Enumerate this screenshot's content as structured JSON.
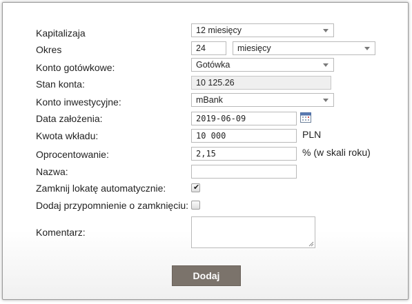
{
  "form": {
    "capitalization": {
      "label": "Kapitalizaja",
      "value": "12 miesięcy"
    },
    "period": {
      "label": "Okres",
      "value": "24",
      "unit": "miesięcy"
    },
    "cash_account": {
      "label": "Konto gotówkowe:",
      "value": "Gotówka"
    },
    "balance": {
      "label": "Stan konta:",
      "value": "10 125.26"
    },
    "investment_account": {
      "label": "Konto inwestycyjne:",
      "value": "mBank"
    },
    "start_date": {
      "label": "Data założenia:",
      "value": "2019-06-09"
    },
    "deposit_amount": {
      "label": "Kwota wkładu:",
      "value": "10 000",
      "suffix": "PLN"
    },
    "interest_rate": {
      "label": "Oprocentowanie:",
      "value": "2,15",
      "suffix": "% (w skali roku)"
    },
    "name": {
      "label": "Nazwa:",
      "value": ""
    },
    "auto_close": {
      "label": "Zamknij lokatę automatycznie:",
      "checked": true
    },
    "reminder": {
      "label": "Dodaj przypomnienie o zamknięciu:",
      "checked": false
    },
    "comment": {
      "label": "Komentarz:",
      "value": ""
    },
    "submit_label": "Dodaj"
  },
  "icons": {
    "calendar": "calendar-icon",
    "dropdown": "chevron-down-icon",
    "checkmark": "checkmark-icon",
    "resize": "resize-grip-icon"
  },
  "colors": {
    "button_bg": "#7b736b",
    "button_text": "#ffffff",
    "readonly_bg": "#efefef",
    "border": "#b9b9b9"
  }
}
